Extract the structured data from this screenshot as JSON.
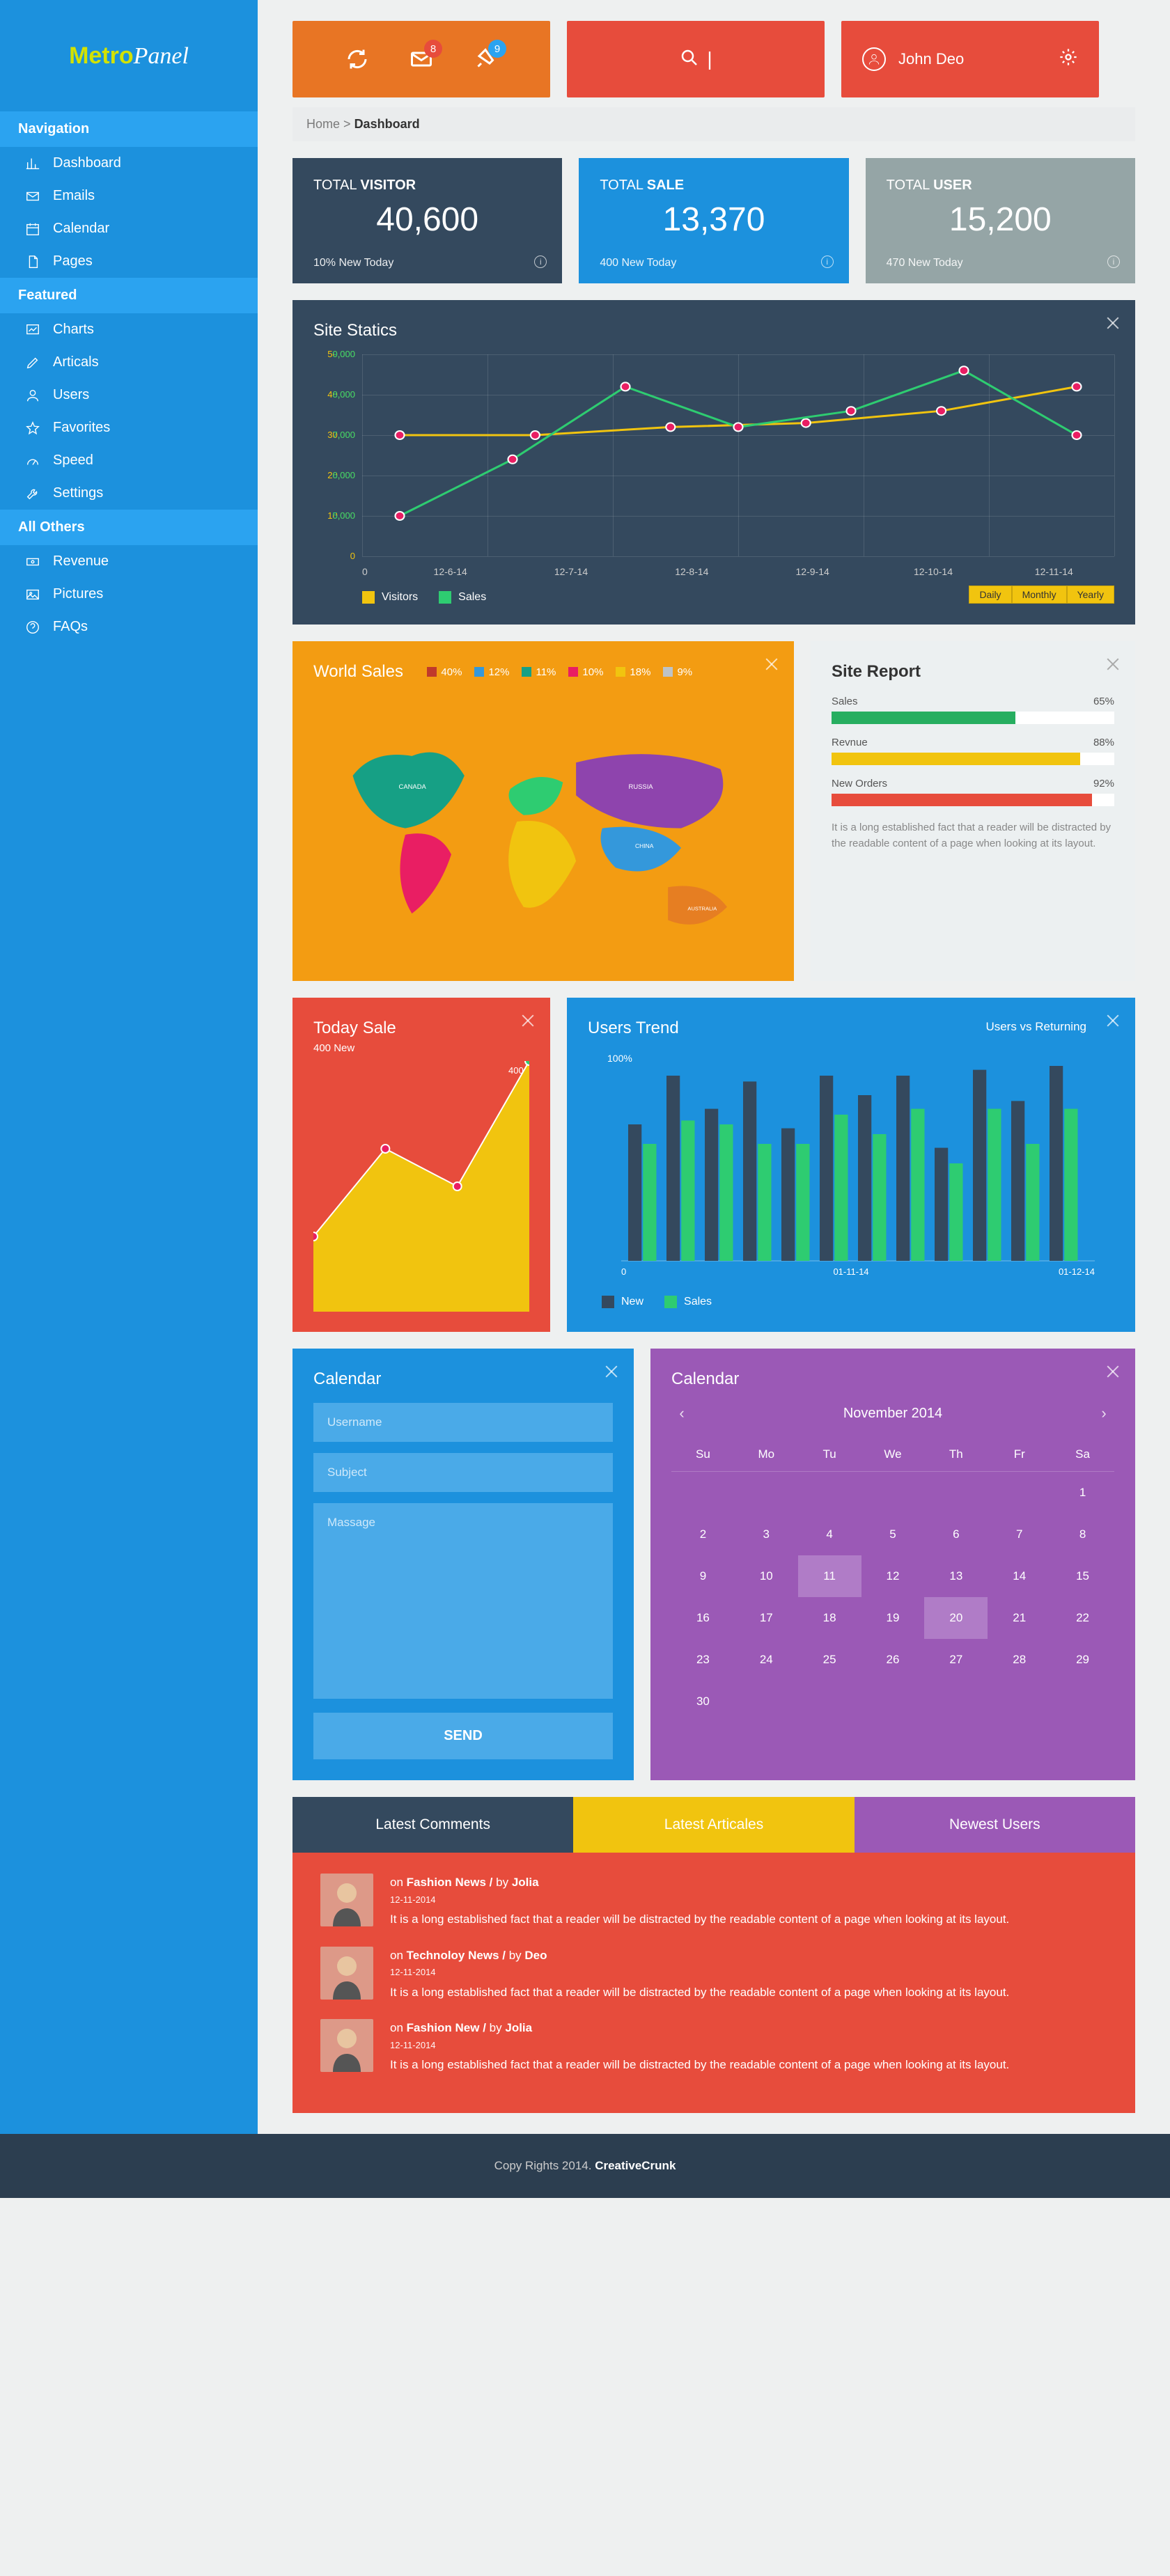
{
  "logo": {
    "part1": "Metro",
    "part2": "Panel"
  },
  "topbar": {
    "badge_msg": "8",
    "badge_bell": "9",
    "username": "John Deo"
  },
  "breadcrumb": {
    "home": "Home",
    "sep": ">",
    "current": "Dashboard"
  },
  "nav": {
    "sections": [
      {
        "title": "Navigation",
        "items": [
          {
            "label": "Dashboard",
            "icon": "chart"
          },
          {
            "label": "Emails",
            "icon": "mail"
          },
          {
            "label": "Calendar",
            "icon": "calendar"
          },
          {
            "label": "Pages",
            "icon": "page"
          }
        ]
      },
      {
        "title": "Featured",
        "items": [
          {
            "label": "Charts",
            "icon": "graph"
          },
          {
            "label": "Articals",
            "icon": "pencil"
          },
          {
            "label": "Users",
            "icon": "user"
          },
          {
            "label": "Favorites",
            "icon": "star"
          },
          {
            "label": "Speed",
            "icon": "gauge"
          },
          {
            "label": "Settings",
            "icon": "wrench"
          }
        ]
      },
      {
        "title": "All Others",
        "items": [
          {
            "label": "Revenue",
            "icon": "money"
          },
          {
            "label": "Pictures",
            "icon": "image"
          },
          {
            "label": "FAQs",
            "icon": "help"
          }
        ]
      }
    ]
  },
  "stats": [
    {
      "label_pre": "TOTAL ",
      "label_b": "VISITOR",
      "value": "40,600",
      "foot": "10% New Today",
      "color": "dark"
    },
    {
      "label_pre": "TOTAL ",
      "label_b": "SALE",
      "value": "13,370",
      "foot": "400 New Today",
      "color": "blue"
    },
    {
      "label_pre": "TOTAL ",
      "label_b": "USER",
      "value": "15,200",
      "foot": "470 New Today",
      "color": "grey"
    }
  ],
  "chart_data": [
    {
      "id": "site_statics",
      "type": "line",
      "title": "Site Statics",
      "x": [
        "12-6-14",
        "12-7-14",
        "12-8-14",
        "12-9-14",
        "12-10-14",
        "12-11-14"
      ],
      "series": [
        {
          "name": "Visitors",
          "color": "#f1c40f",
          "values": [
            30000,
            30000,
            32000,
            33000,
            36000,
            42000
          ]
        },
        {
          "name": "Sales",
          "color": "#2ecc71",
          "values": [
            10000,
            24000,
            42000,
            32000,
            36000,
            46000,
            30000
          ]
        }
      ],
      "ylim": [
        0,
        50000
      ],
      "y_ticks": [
        50000,
        40000,
        30000,
        20000,
        10000,
        0
      ],
      "y_ticks_secondary": [
        9000,
        8000,
        7000,
        6000,
        5000
      ],
      "period_options": [
        "Daily",
        "Monthly",
        "Yearly"
      ]
    },
    {
      "id": "world_sales",
      "type": "map",
      "title": "World Sales",
      "legend": [
        {
          "label": "40%",
          "color": "#c0392b"
        },
        {
          "label": "12%",
          "color": "#3498db"
        },
        {
          "label": "11%",
          "color": "#16a085"
        },
        {
          "label": "10%",
          "color": "#e91e63"
        },
        {
          "label": "18%",
          "color": "#f1c40f"
        },
        {
          "label": "9%",
          "color": "#bdc3c7"
        }
      ]
    },
    {
      "id": "site_report",
      "type": "bar",
      "title": "Site Report",
      "rows": [
        {
          "label": "Sales",
          "value": 65,
          "color": "#27ae60"
        },
        {
          "label": "Revnue",
          "value": 88,
          "color": "#f1c40f"
        },
        {
          "label": "New Orders",
          "value": 92,
          "color": "#e74c3c"
        }
      ],
      "text": "It is a long established fact that a reader will be distracted by the readable content of a page when looking at its layout."
    },
    {
      "id": "today_sale",
      "type": "area",
      "title": "Today Sale",
      "subtitle": "400 New",
      "y_max_label": "400",
      "values": [
        120,
        260,
        200,
        400
      ],
      "ylim": [
        0,
        400
      ],
      "fill": "#f1c40f"
    },
    {
      "id": "users_trend",
      "type": "bar",
      "title": "Users Trend",
      "subtitle": "Users vs Returning",
      "ylabel_top": "100%",
      "categories_span": [
        "0",
        "01-11-14",
        "01-12-14"
      ],
      "series": [
        {
          "name": "New",
          "color": "#34495e",
          "values": [
            70,
            95,
            78,
            92,
            68,
            95,
            85,
            95,
            58,
            98,
            82,
            100
          ]
        },
        {
          "name": "Sales",
          "color": "#2ecc71",
          "values": [
            60,
            72,
            70,
            60,
            60,
            75,
            65,
            78,
            50,
            78,
            60,
            78
          ]
        }
      ],
      "ylim": [
        0,
        100
      ]
    }
  ],
  "calendar_form": {
    "title": "Calendar",
    "ph_user": "Username",
    "ph_subject": "Subject",
    "ph_msg": "Massage",
    "send": "SEND"
  },
  "calendar": {
    "title": "Calendar",
    "month": "November 2014",
    "dow": [
      "Su",
      "Mo",
      "Tu",
      "We",
      "Th",
      "Fr",
      "Sa"
    ],
    "weeks": [
      [
        "",
        "",
        "",
        "",
        "",
        "",
        "1"
      ],
      [
        "2",
        "3",
        "4",
        "5",
        "6",
        "7",
        "8"
      ],
      [
        "9",
        "10",
        "11",
        "12",
        "13",
        "14",
        "15"
      ],
      [
        "16",
        "17",
        "18",
        "19",
        "20",
        "21",
        "22"
      ],
      [
        "23",
        "24",
        "25",
        "26",
        "27",
        "28",
        "29"
      ],
      [
        "30",
        "",
        "",
        "",
        "",
        "",
        ""
      ]
    ],
    "selected": [
      "11",
      "20"
    ]
  },
  "tabs": {
    "t1": "Latest Comments",
    "t2": "Latest Articales",
    "t3": "Newest Users"
  },
  "comments": [
    {
      "on": "on ",
      "cat": "Fashion News / ",
      "by": "by ",
      "author": "Jolia",
      "date": "12-11-2014",
      "text": "It is a long established fact that a reader will be distracted by the readable content of a page when looking at its layout."
    },
    {
      "on": "on ",
      "cat": "Technoloy News / ",
      "by": "by ",
      "author": "Deo",
      "date": "12-11-2014",
      "text": "It is a long established fact that a reader will be distracted by the readable content of a page when looking at its layout."
    },
    {
      "on": "on ",
      "cat": "Fashion New / ",
      "by": "by ",
      "author": "Jolia",
      "date": "12-11-2014",
      "text": "It is a long established fact that a reader will be distracted by the readable content of a page when looking at its layout."
    }
  ],
  "footer": {
    "pre": "Copy Rights 2014. ",
    "brand": "CreativeCrunk"
  }
}
